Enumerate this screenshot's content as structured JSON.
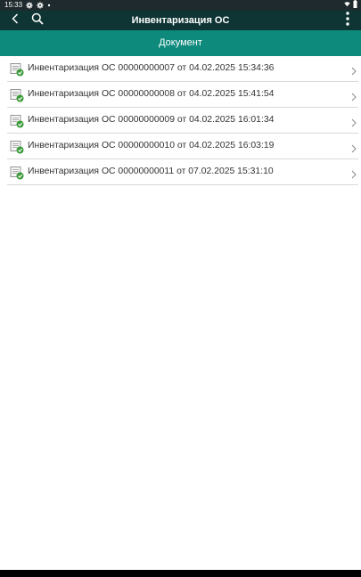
{
  "status_bar": {
    "time": "15:33"
  },
  "app_bar": {
    "title": "Инвентаризация ОС"
  },
  "section": {
    "header": "Документ"
  },
  "documents": [
    {
      "label": "Инвентаризация ОС 00000000007 от 04.02.2025 15:34:36"
    },
    {
      "label": "Инвентаризация ОС 00000000008 от 04.02.2025 15:41:54"
    },
    {
      "label": "Инвентаризация ОС 00000000009 от 04.02.2025 16:01:34"
    },
    {
      "label": "Инвентаризация ОС 00000000010 от 04.02.2025 16:03:19"
    },
    {
      "label": "Инвентаризация ОС 00000000011 от 07.02.2025 15:31:10"
    }
  ],
  "colors": {
    "status_bar": "#1f2a2e",
    "app_bar": "#0e3434",
    "section_header": "#0e8a7d",
    "check_green": "#3a9a3a"
  }
}
